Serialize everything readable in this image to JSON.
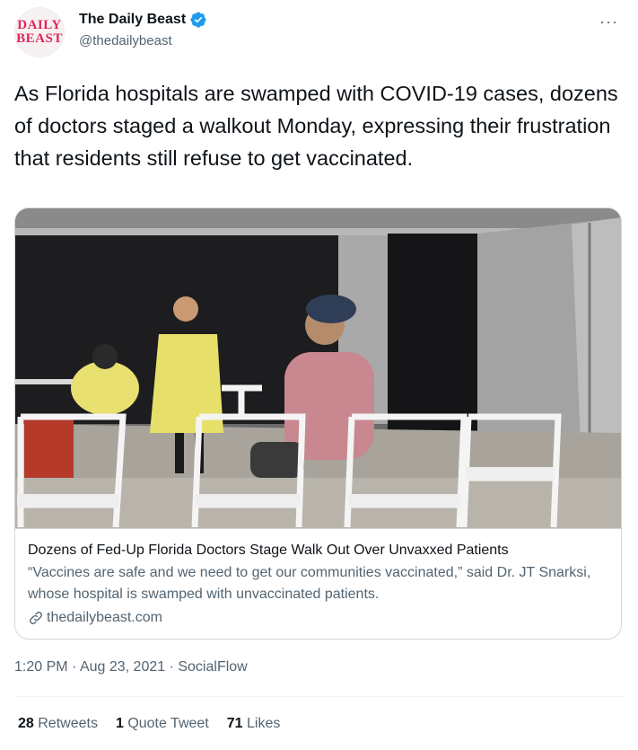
{
  "author": {
    "logo_line1": "DAILY",
    "logo_line2": "BEAST",
    "name": "The Daily Beast",
    "handle": "@thedailybeast"
  },
  "more_icon": "···",
  "tweet_text": "As Florida hospitals are swamped with COVID-19 cases, dozens of doctors staged a walkout Monday, expressing their frustration that residents still refuse to get vaccinated.",
  "card": {
    "title": "Dozens of Fed-Up Florida Doctors Stage Walk Out Over Unvaxxed Patients",
    "description": "“Vaccines are safe and we need to get our communities vaccinated,” said Dr. JT Snarksi, whose hospital is swamped with unvaccinated patients.",
    "domain": "thedailybeast.com",
    "icon": "link-icon"
  },
  "meta": {
    "time": "1:20 PM",
    "sep1": " · ",
    "date": "Aug 23, 2021",
    "sep2": " · ",
    "source": "SocialFlow"
  },
  "stats": {
    "retweets_count": "28",
    "retweets_label": "Retweets",
    "quotes_count": "1",
    "quotes_label": "Quote Tweet",
    "likes_count": "71",
    "likes_label": "Likes"
  },
  "colors": {
    "verified": "#1d9bf0",
    "brand_red": "#e0245e",
    "secondary_text": "#536471"
  }
}
